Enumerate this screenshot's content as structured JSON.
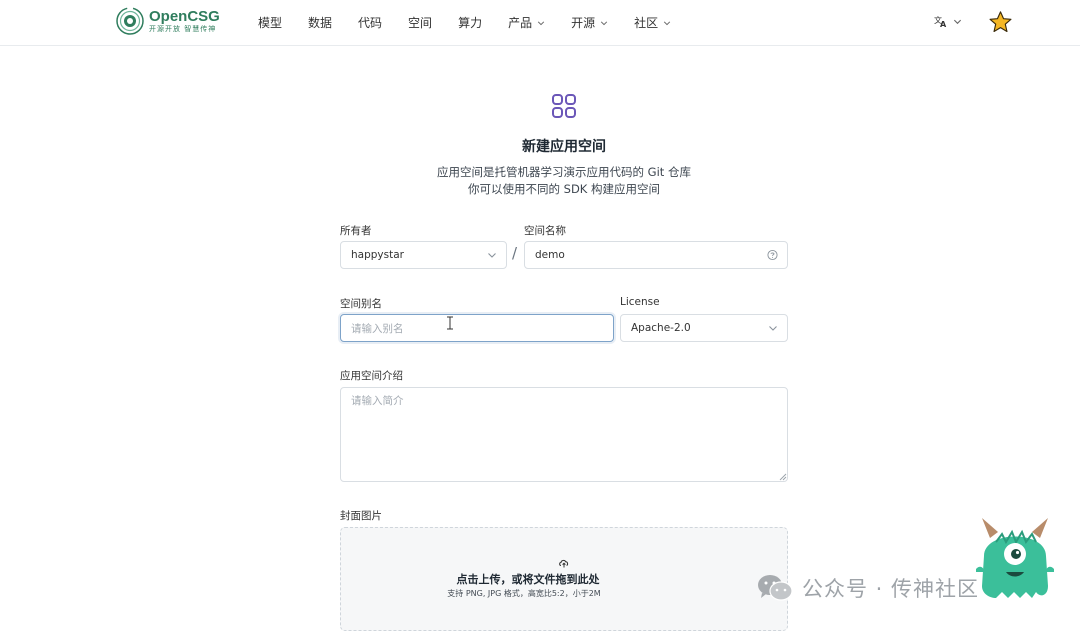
{
  "brand": {
    "name": "OpenCSG",
    "slogan": "开源开放 智慧传神",
    "color": "#2f7d5d"
  },
  "nav": {
    "items": [
      {
        "label": "模型",
        "dropdown": false
      },
      {
        "label": "数据",
        "dropdown": false
      },
      {
        "label": "代码",
        "dropdown": false
      },
      {
        "label": "空间",
        "dropdown": false
      },
      {
        "label": "算力",
        "dropdown": false
      },
      {
        "label": "产品",
        "dropdown": true
      },
      {
        "label": "开源",
        "dropdown": true
      },
      {
        "label": "社区",
        "dropdown": true
      }
    ],
    "language_icon": "translate-icon",
    "star_icon": "star-icon"
  },
  "page": {
    "icon": "grid-apps-icon",
    "title": "新建应用空间",
    "subtitle_line1": "应用空间是托管机器学习演示应用代码的 Git 仓库",
    "subtitle_line2": "你可以使用不同的 SDK 构建应用空间"
  },
  "form": {
    "owner": {
      "label": "所有者",
      "value": "happystar"
    },
    "separator": "/",
    "space_name": {
      "label": "空间名称",
      "value": "demo"
    },
    "alias": {
      "label": "空间别名",
      "placeholder": "请输入别名",
      "value": ""
    },
    "license": {
      "label": "License",
      "value": "Apache-2.0"
    },
    "intro": {
      "label": "应用空间介绍",
      "placeholder": "请输入简介",
      "value": ""
    },
    "cover": {
      "label": "封面图片",
      "upload_title": "点击上传，或将文件拖到此处",
      "upload_hint": "支持 PNG, JPG 格式，高宽比5:2，小于2M"
    }
  },
  "watermark": {
    "text": "公众号 · 传神社区",
    "icon": "wechat-icon"
  },
  "colors": {
    "accent_purple": "#6b57b8",
    "star": "#f5b724",
    "focus_border": "#7ea3c9"
  }
}
